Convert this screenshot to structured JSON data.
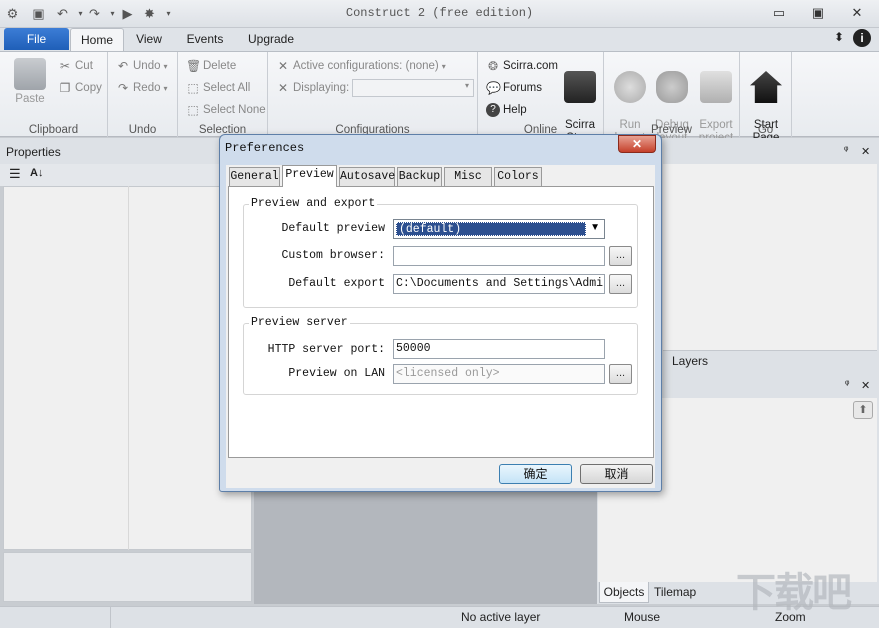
{
  "window": {
    "title": "Construct 2  (free edition)",
    "minimize_glyph": "▭",
    "restore_glyph": "▣",
    "close_glyph": "✕"
  },
  "ribbon_tabs": {
    "file": "File",
    "home": "Home",
    "view": "View",
    "events": "Events",
    "upgrade": "Upgrade"
  },
  "clipboard": {
    "paste": "Paste",
    "cut": "Cut",
    "copy": "Copy",
    "label": "Clipboard"
  },
  "undo": {
    "undo": "Undo",
    "redo": "Redo",
    "label": "Undo"
  },
  "selection": {
    "delete": "Delete",
    "select_all": "Select All",
    "select_none": "Select None",
    "label": "Selection"
  },
  "configurations": {
    "active": "Active configurations: (none)",
    "displaying": "Displaying:",
    "label": "Configurations"
  },
  "online": {
    "scirra": "Scirra.com",
    "forums": "Forums",
    "help": "Help",
    "store": "Scirra\nStore",
    "label": "Online"
  },
  "preview": {
    "run": "Run\nlayout",
    "debug": "Debug\nlayout",
    "export": "Export\nproject",
    "label": "Preview"
  },
  "go": {
    "start": "Start\nPage",
    "label": "Go"
  },
  "panels": {
    "properties": "Properties",
    "layers": "Layers",
    "objects": "Objects",
    "tilemap": "Tilemap",
    "pin": "ᵠ",
    "close": "✕",
    "sort_ab": "A↓"
  },
  "status": {
    "layer": "No active layer",
    "mouse": "Mouse",
    "zoom": "Zoom"
  },
  "dialog": {
    "title": "Preferences",
    "tabs": [
      "General",
      "Preview",
      "Autosave",
      "Backup",
      "Misc",
      "Colors"
    ],
    "preview_export": {
      "legend": "Preview and export",
      "default_preview_label": "Default preview",
      "default_preview_value": "(default)",
      "custom_browser_label": "Custom browser:",
      "custom_browser_value": "",
      "default_export_label": "Default export",
      "default_export_value": "C:\\Documents and Settings\\Administrator"
    },
    "preview_server": {
      "legend": "Preview server",
      "port_label": "HTTP server port:",
      "port_value": "50000",
      "lan_label": "Preview on LAN",
      "lan_placeholder": "<licensed only>"
    },
    "browse": "...",
    "ok": "确定",
    "cancel": "取消"
  },
  "watermark": "下载吧",
  "colors": {
    "file_tab": "#1f5fb8",
    "dialog_frame": "#cfdcec",
    "selection": "#2c4f8f"
  }
}
